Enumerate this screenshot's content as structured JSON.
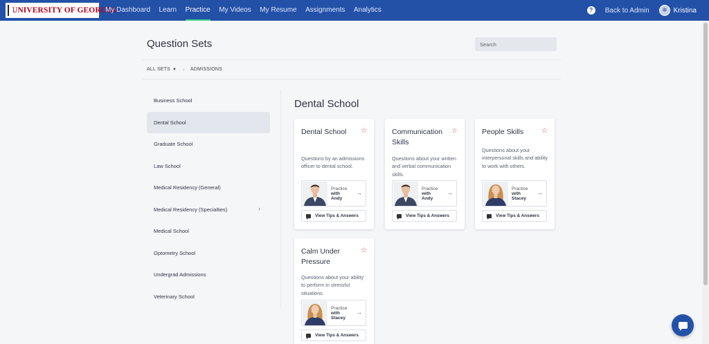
{
  "nav": {
    "logo_text": "UNIVERSITY OF GEORGIA",
    "links": [
      "My Dashboard",
      "Learn",
      "Practice",
      "My Videos",
      "My Resume",
      "Assignments",
      "Analytics"
    ],
    "active": "Practice",
    "help_label": "?",
    "back_admin": "Back to Admin",
    "user_name": "Kristina",
    "accent_color": "#3ed28a",
    "bar_color": "#2351a8"
  },
  "header": {
    "title": "Question Sets",
    "search_placeholder": "Search"
  },
  "breadcrumb": {
    "root": "ALL SETS",
    "current": "ADMISSIONS"
  },
  "sidebar": {
    "items": [
      {
        "label": "Business School"
      },
      {
        "label": "Dental School",
        "active": true
      },
      {
        "label": "Graduate School"
      },
      {
        "label": "Law School"
      },
      {
        "label": "Medical Residency (General)"
      },
      {
        "label": "Medical Residency (Specialties)",
        "has_children": true
      },
      {
        "label": "Medical School"
      },
      {
        "label": "Optometry School"
      },
      {
        "label": "Undergrad Admissions"
      },
      {
        "label": "Veterinary School"
      }
    ]
  },
  "main": {
    "section_title": "Dental School",
    "cards": [
      {
        "title": "Dental School",
        "description": "Questions by an admissions officer to dental school.",
        "practice_prefix": "Practice",
        "practice_with": "with",
        "coach": "Andy",
        "tips_label": "View Tips & Answers"
      },
      {
        "title": "Communication Skills",
        "description": "Questions about your written and verbal communication skills.",
        "practice_prefix": "Practice",
        "practice_with": "with",
        "coach": "Andy",
        "tips_label": "View Tips & Answers"
      },
      {
        "title": "People Skills",
        "description": "Questions about your interpersonal skills and ability to work with others.",
        "practice_prefix": "Practice",
        "practice_with": "with",
        "coach": "Stacey",
        "tips_label": "View Tips & Answers"
      },
      {
        "title": "Calm Under Pressure",
        "description": "Questions about your ability to perform in stressful situations.",
        "practice_prefix": "Practice",
        "practice_with": "with",
        "coach": "Stacey",
        "tips_label": "View Tips & Answers"
      }
    ]
  }
}
